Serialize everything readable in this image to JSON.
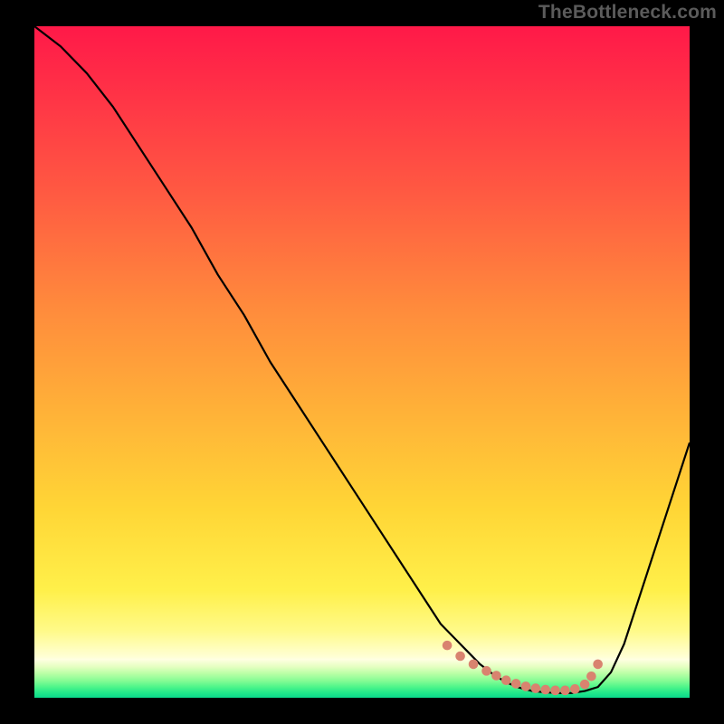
{
  "watermark": "TheBottleneck.com",
  "chart_data": {
    "type": "line",
    "title": "",
    "xlabel": "",
    "ylabel": "",
    "xlim": [
      0,
      100
    ],
    "ylim": [
      0,
      100
    ],
    "grid": false,
    "background": "rainbow-gradient",
    "series": [
      {
        "name": "bottleneck-curve",
        "color": "#000000",
        "x": [
          0,
          4,
          8,
          12,
          16,
          20,
          24,
          28,
          32,
          36,
          40,
          44,
          48,
          52,
          56,
          60,
          62,
          64,
          66,
          68,
          70,
          72,
          74,
          76,
          78,
          80,
          82,
          84,
          86,
          88,
          90,
          92,
          94,
          96,
          98,
          100
        ],
        "y": [
          100,
          97,
          93,
          88,
          82,
          76,
          70,
          63,
          57,
          50,
          44,
          38,
          32,
          26,
          20,
          14,
          11,
          9,
          7,
          5,
          3.5,
          2.3,
          1.5,
          1.0,
          0.8,
          0.7,
          0.7,
          1.0,
          1.6,
          3.8,
          8.0,
          14,
          20,
          26,
          32,
          38
        ]
      }
    ],
    "markers": {
      "name": "low-zone-dots",
      "color": "#d9836f",
      "x": [
        63,
        65,
        67,
        69,
        70.5,
        72,
        73.5,
        75,
        76.5,
        78,
        79.5,
        81,
        82.5,
        84,
        85,
        86
      ],
      "y": [
        7.8,
        6.2,
        5.0,
        4.0,
        3.3,
        2.6,
        2.1,
        1.7,
        1.4,
        1.2,
        1.1,
        1.1,
        1.3,
        2.0,
        3.2,
        5.0
      ]
    }
  }
}
